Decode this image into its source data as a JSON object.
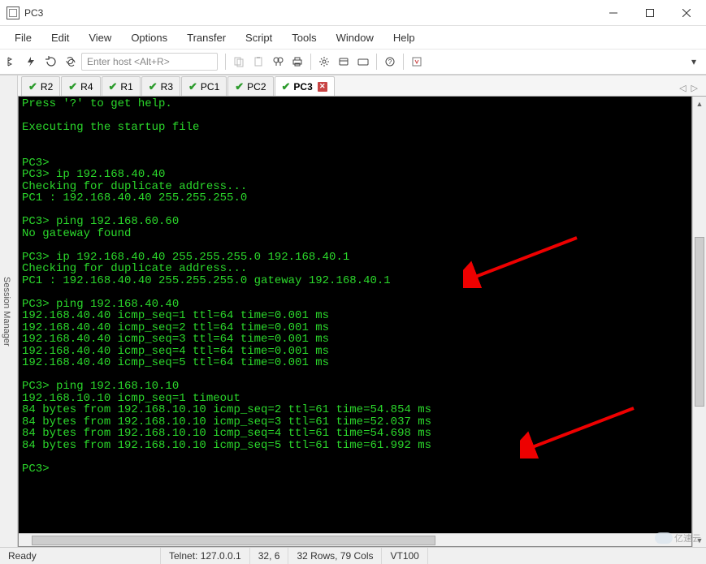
{
  "window": {
    "title": "PC3"
  },
  "menu": {
    "file": "File",
    "edit": "Edit",
    "view": "View",
    "options": "Options",
    "transfer": "Transfer",
    "script": "Script",
    "tools": "Tools",
    "window": "Window",
    "help": "Help"
  },
  "toolbar": {
    "host_placeholder": "Enter host <Alt+R>"
  },
  "side": {
    "label": "Session Manager"
  },
  "tabs": [
    {
      "label": "R2",
      "active": false
    },
    {
      "label": "R4",
      "active": false
    },
    {
      "label": "R1",
      "active": false
    },
    {
      "label": "R3",
      "active": false
    },
    {
      "label": "PC1",
      "active": false
    },
    {
      "label": "PC2",
      "active": false
    },
    {
      "label": "PC3",
      "active": true
    }
  ],
  "tabnav": {
    "left": "◁",
    "right": "▷"
  },
  "terminal": {
    "lines": "Press '?' to get help.\n\nExecuting the startup file\n\n\nPC3>\nPC3> ip 192.168.40.40\nChecking for duplicate address...\nPC1 : 192.168.40.40 255.255.255.0\n\nPC3> ping 192.168.60.60\nNo gateway found\n\nPC3> ip 192.168.40.40 255.255.255.0 192.168.40.1\nChecking for duplicate address...\nPC1 : 192.168.40.40 255.255.255.0 gateway 192.168.40.1\n\nPC3> ping 192.168.40.40\n192.168.40.40 icmp_seq=1 ttl=64 time=0.001 ms\n192.168.40.40 icmp_seq=2 ttl=64 time=0.001 ms\n192.168.40.40 icmp_seq=3 ttl=64 time=0.001 ms\n192.168.40.40 icmp_seq=4 ttl=64 time=0.001 ms\n192.168.40.40 icmp_seq=5 ttl=64 time=0.001 ms\n\nPC3> ping 192.168.10.10\n192.168.10.10 icmp_seq=1 timeout\n84 bytes from 192.168.10.10 icmp_seq=2 ttl=61 time=54.854 ms\n84 bytes from 192.168.10.10 icmp_seq=3 ttl=61 time=52.037 ms\n84 bytes from 192.168.10.10 icmp_seq=4 ttl=61 time=54.698 ms\n84 bytes from 192.168.10.10 icmp_seq=5 ttl=61 time=61.992 ms\n\nPC3> "
  },
  "status": {
    "ready": "Ready",
    "telnet": "Telnet: 127.0.0.1",
    "pos": "32,  6",
    "size": "32 Rows, 79 Cols",
    "term": "VT100"
  },
  "watermark": "亿速云"
}
